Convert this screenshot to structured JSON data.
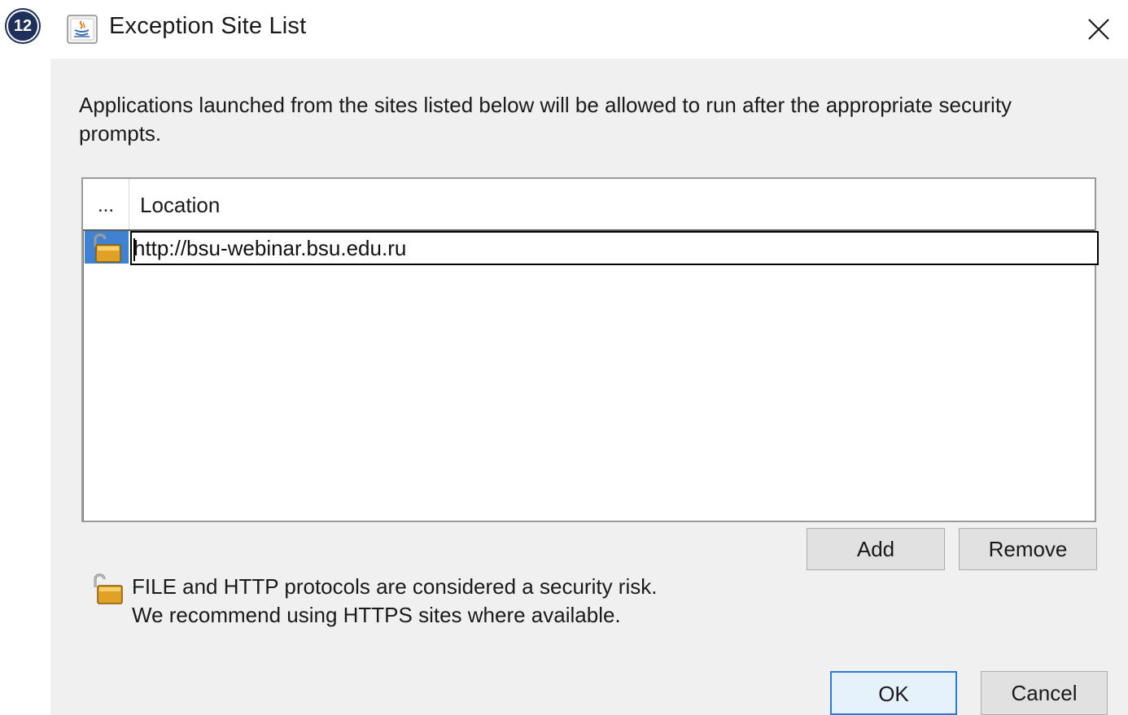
{
  "step_marker": "12",
  "window": {
    "title": "Exception Site List",
    "app_icon": "java-cup-icon",
    "close_icon": "close-icon"
  },
  "intro_text": "Applications launched from the sites listed below will be allowed to run after the appropriate security prompts.",
  "table": {
    "columns": [
      "...",
      "Location"
    ],
    "rows": [
      {
        "icon": "unlocked-padlock-icon",
        "location": "http://bsu-webinar.bsu.edu.ru",
        "editing": true
      }
    ]
  },
  "buttons": {
    "add": "Add",
    "remove": "Remove",
    "ok": "OK",
    "cancel": "Cancel"
  },
  "warning": {
    "icon": "unlocked-padlock-icon",
    "line1": "FILE and HTTP protocols are considered a security risk.",
    "line2": "We recommend using HTTPS sites where available."
  },
  "colors": {
    "selection": "#3f82d1",
    "dialog_bg": "#f0f0f0",
    "default_button_border": "#2b7ad6",
    "step_marker_bg": "#1f2f5c"
  }
}
